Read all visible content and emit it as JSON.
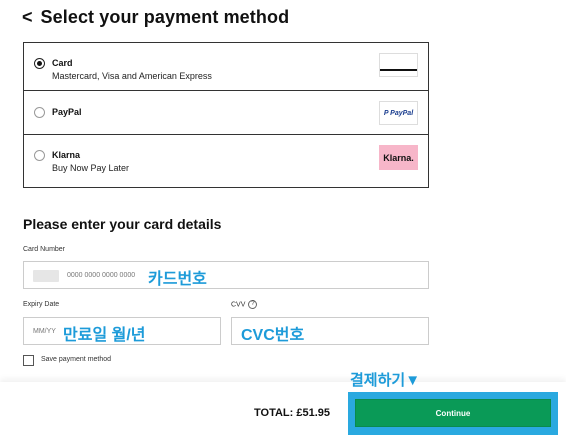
{
  "header": {
    "back_icon": "chevron-left-icon",
    "back_glyph": "<",
    "title": "Select your payment method"
  },
  "payment_methods": [
    {
      "name": "Card",
      "subtitle": "Mastercard, Visa and American Express",
      "selected": true,
      "logo": "card-icon"
    },
    {
      "name": "PayPal",
      "subtitle": "",
      "selected": false,
      "logo_text": "P PayPal"
    },
    {
      "name": "Klarna",
      "subtitle": "Buy Now Pay Later",
      "selected": false,
      "logo_text": "Klarna.",
      "logo_color": "#f7b6c9"
    }
  ],
  "card_details": {
    "title": "Please enter your card details",
    "card_number": {
      "label": "Card Number",
      "placeholder": "0000 0000 0000 0000",
      "annotation": "카드번호"
    },
    "expiry": {
      "label": "Expiry Date",
      "placeholder": "MM/YY",
      "annotation": "만료일 월/년"
    },
    "cvv": {
      "label": "CVV",
      "help_glyph": "?",
      "annotation": "CVC번호"
    },
    "save_payment_label": "Save payment method"
  },
  "footer": {
    "total": "TOTAL: £51.95",
    "continue_label": "Continue",
    "annotation": "결제하기▼",
    "accent": "#0a9a57",
    "highlight": "#2aa9e0"
  }
}
